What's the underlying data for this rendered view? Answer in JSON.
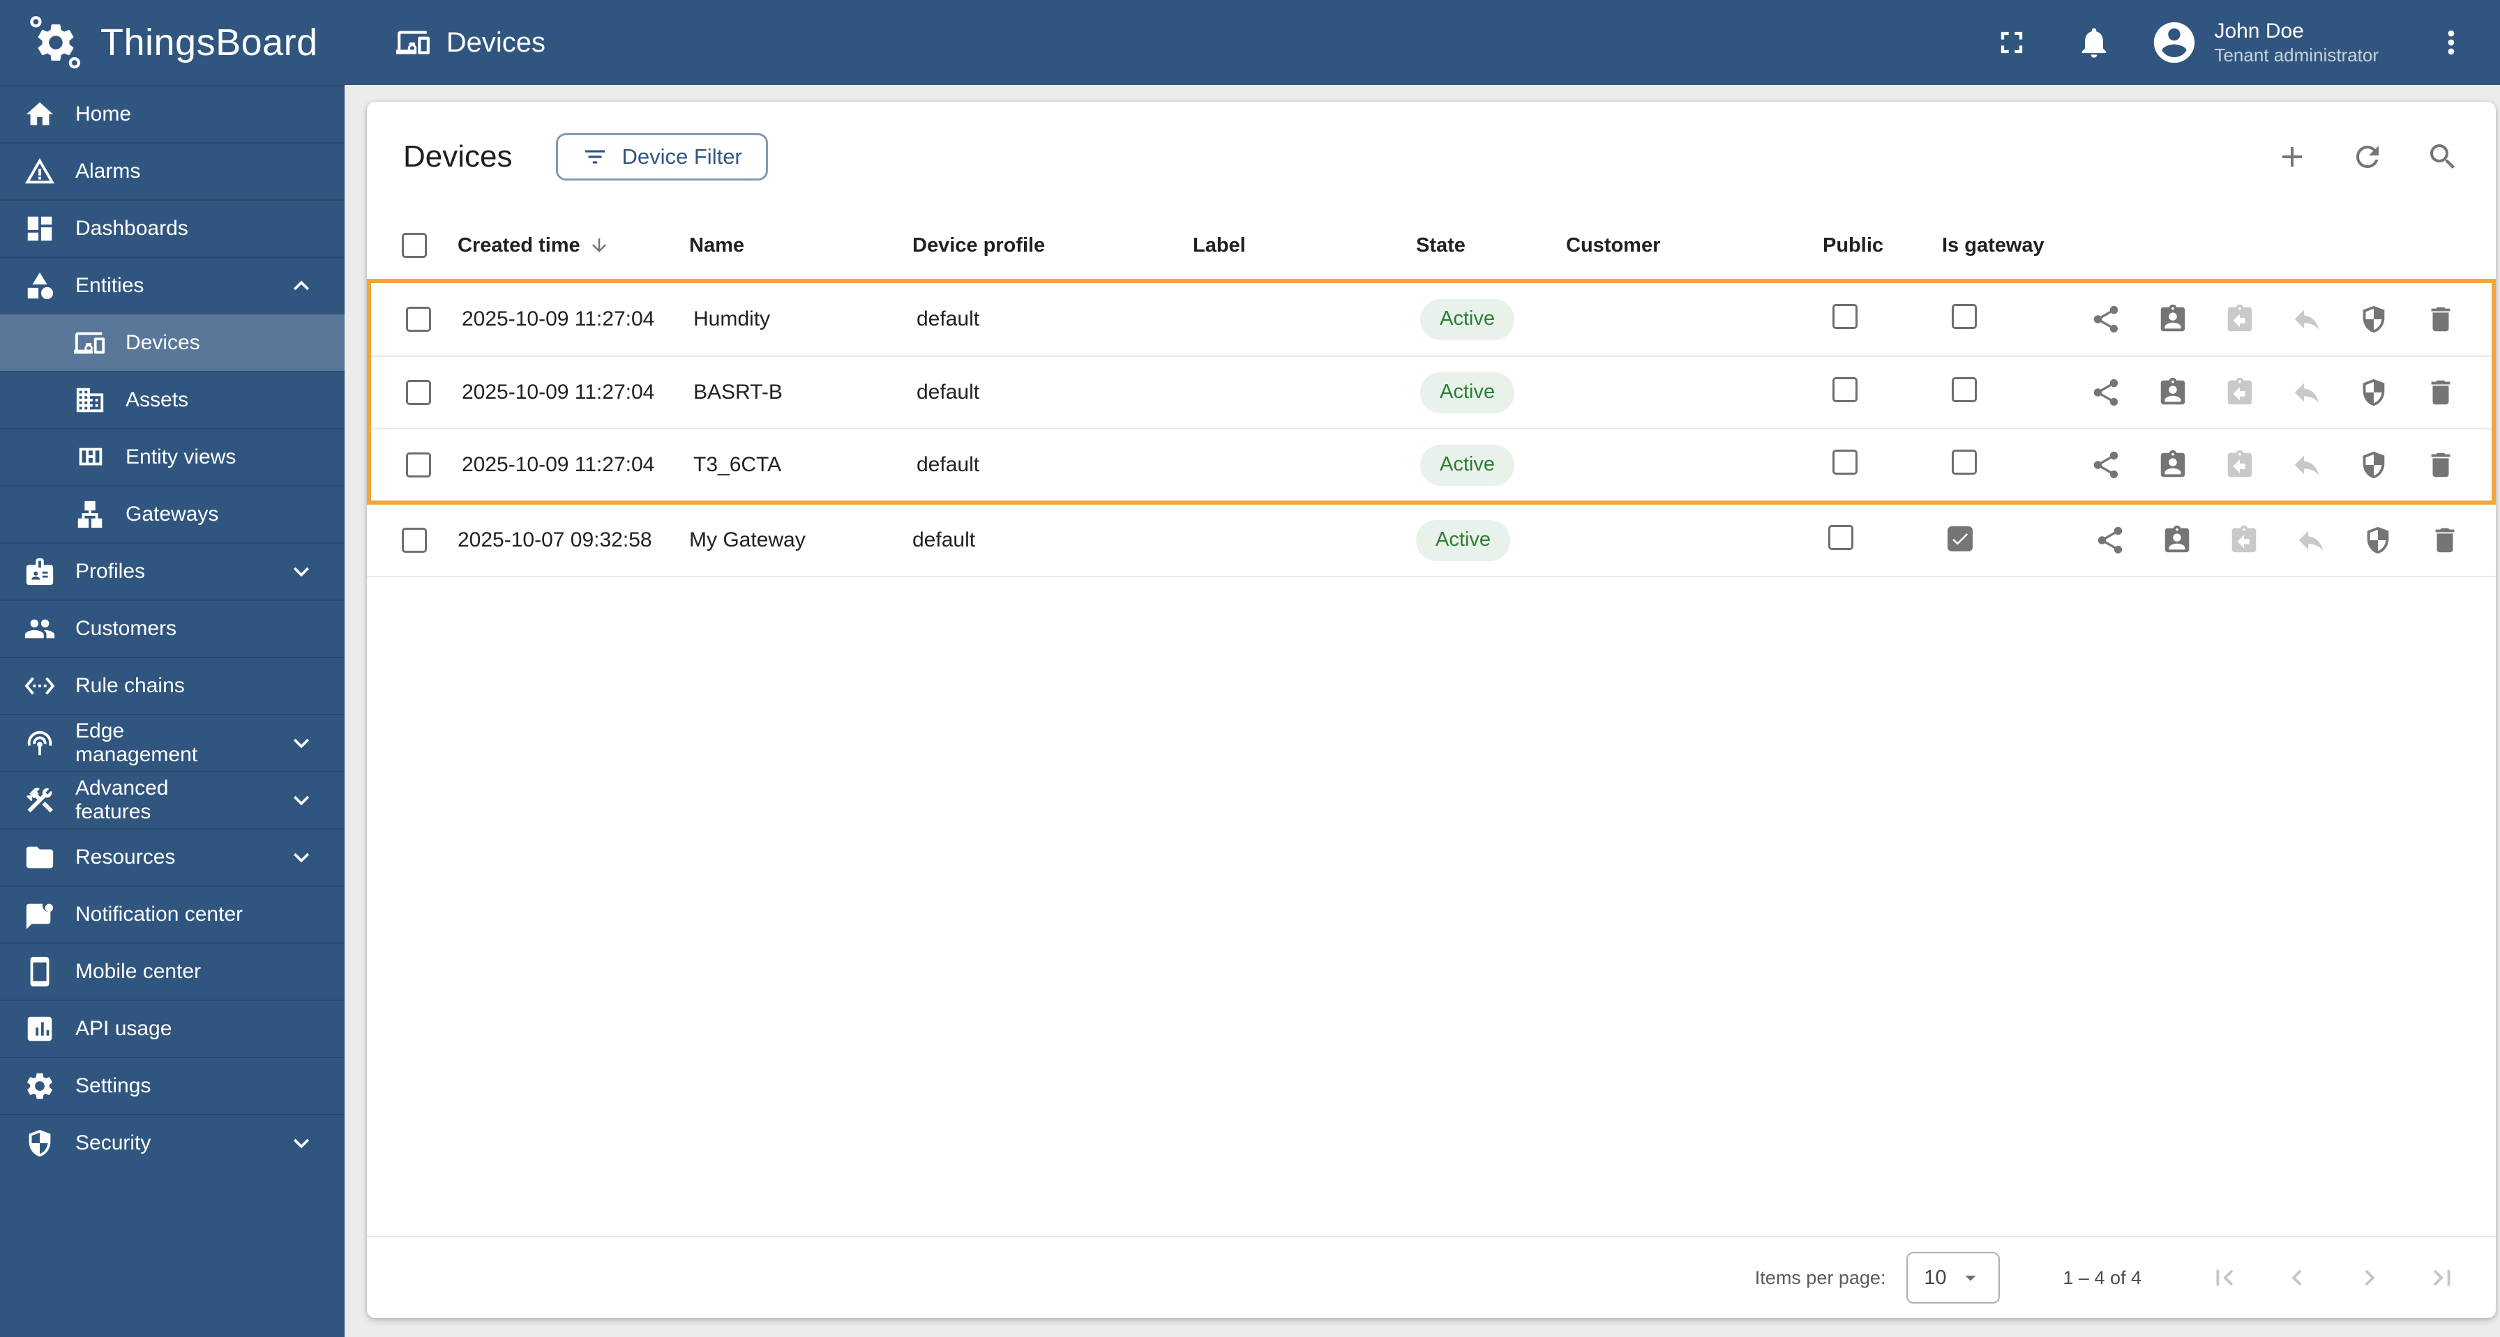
{
  "colors": {
    "primary": "#305680",
    "highlight_border": "#f3a53d",
    "active_badge_bg": "#e9f2ea",
    "active_badge_text": "#2b7d33"
  },
  "topbar": {
    "brand": "ThingsBoard",
    "section_title": "Devices",
    "section_icon": "devices-icon",
    "icons": [
      "fullscreen-icon",
      "notifications-icon",
      "avatar-icon",
      "more-vert-icon"
    ],
    "user": {
      "name": "John Doe",
      "role": "Tenant administrator"
    }
  },
  "sidebar": {
    "items": [
      {
        "label": "Home",
        "icon": "home-icon"
      },
      {
        "label": "Alarms",
        "icon": "alarms-icon"
      },
      {
        "label": "Dashboards",
        "icon": "dashboards-icon"
      },
      {
        "label": "Entities",
        "icon": "entities-icon",
        "expandable": true,
        "expanded": true
      },
      {
        "label": "Devices",
        "icon": "devices-icon",
        "sub": true,
        "selected": true
      },
      {
        "label": "Assets",
        "icon": "assets-icon",
        "sub": true
      },
      {
        "label": "Entity views",
        "icon": "entity-views-icon",
        "sub": true
      },
      {
        "label": "Gateways",
        "icon": "gateways-icon",
        "sub": true
      },
      {
        "label": "Profiles",
        "icon": "profiles-icon",
        "expandable": true
      },
      {
        "label": "Customers",
        "icon": "customers-icon"
      },
      {
        "label": "Rule chains",
        "icon": "rule-chains-icon"
      },
      {
        "label": "Edge management",
        "icon": "edge-management-icon",
        "expandable": true
      },
      {
        "label": "Advanced features",
        "icon": "advanced-features-icon",
        "expandable": true
      },
      {
        "label": "Resources",
        "icon": "resources-icon",
        "expandable": true
      },
      {
        "label": "Notification center",
        "icon": "notification-center-icon"
      },
      {
        "label": "Mobile center",
        "icon": "mobile-center-icon"
      },
      {
        "label": "API usage",
        "icon": "api-usage-icon"
      },
      {
        "label": "Settings",
        "icon": "settings-icon"
      },
      {
        "label": "Security",
        "icon": "security-icon",
        "expandable": true
      }
    ]
  },
  "page": {
    "title": "Devices",
    "filter_button_label": "Device Filter",
    "filter_button_icon": "filter-icon",
    "toolbar_icons": [
      "add-icon",
      "refresh-icon",
      "search-icon"
    ]
  },
  "table": {
    "columns": [
      "Created time",
      "Name",
      "Device profile",
      "Label",
      "State",
      "Customer",
      "Public",
      "Is gateway"
    ],
    "sort": {
      "column": "Created time",
      "direction": "desc",
      "icon": "sort-desc-icon"
    },
    "row_actions": [
      {
        "name": "make-public",
        "icon": "share-icon",
        "disabled": false
      },
      {
        "name": "assign-to-customer",
        "icon": "assign-customer-icon",
        "disabled": false
      },
      {
        "name": "unassign-from-customer",
        "icon": "unassign-customer-icon",
        "disabled": true
      },
      {
        "name": "make-private",
        "icon": "make-private-icon",
        "disabled": true
      },
      {
        "name": "manage-credentials",
        "icon": "credentials-icon",
        "disabled": false
      },
      {
        "name": "delete",
        "icon": "delete-icon",
        "disabled": false
      }
    ],
    "rows": [
      {
        "created": "2025-10-09 11:27:04",
        "name": "Humdity",
        "profile": "default",
        "label": "",
        "state": "Active",
        "customer": "",
        "public": false,
        "gateway": false,
        "highlighted": true
      },
      {
        "created": "2025-10-09 11:27:04",
        "name": "BASRT-B",
        "profile": "default",
        "label": "",
        "state": "Active",
        "customer": "",
        "public": false,
        "gateway": false,
        "highlighted": true
      },
      {
        "created": "2025-10-09 11:27:04",
        "name": "T3_6CTA",
        "profile": "default",
        "label": "",
        "state": "Active",
        "customer": "",
        "public": false,
        "gateway": false,
        "highlighted": true
      },
      {
        "created": "2025-10-07 09:32:58",
        "name": "My Gateway",
        "profile": "default",
        "label": "",
        "state": "Active",
        "customer": "",
        "public": false,
        "gateway": true,
        "highlighted": false
      }
    ]
  },
  "paginator": {
    "label": "Items per page:",
    "value": "10",
    "range": "1 – 4 of 4",
    "nav_icons": [
      "first-page-icon",
      "prev-page-icon",
      "next-page-icon",
      "last-page-icon"
    ]
  }
}
